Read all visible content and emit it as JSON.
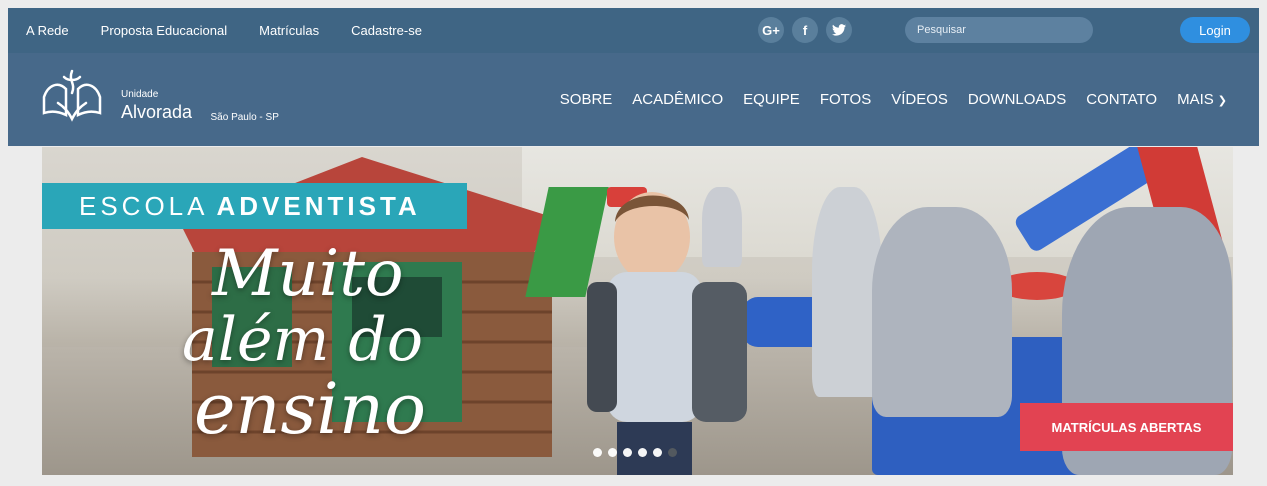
{
  "topbar": {
    "links": [
      "A Rede",
      "Proposta Educacional",
      "Matrículas",
      "Cadastre-se"
    ],
    "social": [
      {
        "icon": "google-plus-icon",
        "glyph": "G+"
      },
      {
        "icon": "facebook-icon",
        "glyph": "f"
      },
      {
        "icon": "twitter-icon",
        "glyph": "✈"
      }
    ],
    "search_placeholder": "Pesquisar",
    "login_label": "Login"
  },
  "header": {
    "unit_label": "Unidade",
    "unit_name": "Alvorada",
    "location": "São Paulo - SP",
    "nav": [
      "SOBRE",
      "ACADÊMICO",
      "EQUIPE",
      "FOTOS",
      "VÍDEOS",
      "DOWNLOADS",
      "CONTATO",
      "MAIS"
    ]
  },
  "hero": {
    "tag_light": "ESCOLA",
    "tag_bold": "ADVENTISTA",
    "script_line1": "Muito",
    "script_line2": "além do",
    "script_line3": "ensino",
    "cta_label": "MATRÍCULAS ABERTAS",
    "slides_count": 6,
    "active_slide": 6
  },
  "colors": {
    "topbar": "#3f6584",
    "mainbar": "#47698a",
    "login": "#2f8fe0",
    "tag": "#2aa6b8",
    "cta": "#e24352"
  }
}
